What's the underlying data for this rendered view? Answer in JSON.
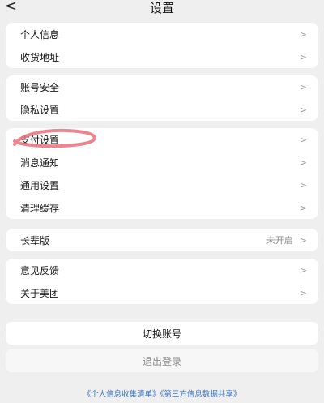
{
  "header": {
    "title": "设置",
    "back_glyph": "<"
  },
  "groups": [
    {
      "items": [
        {
          "label": "个人信息",
          "chevron": ">"
        },
        {
          "label": "收货地址",
          "chevron": ">"
        }
      ]
    },
    {
      "items": [
        {
          "label": "账号安全",
          "chevron": ">"
        },
        {
          "label": "隐私设置",
          "chevron": ">"
        }
      ]
    },
    {
      "items": [
        {
          "label": "支付设置",
          "chevron": ">"
        },
        {
          "label": "消息通知",
          "chevron": ">"
        },
        {
          "label": "通用设置",
          "chevron": ">"
        },
        {
          "label": "清理缓存",
          "chevron": ">"
        }
      ]
    },
    {
      "items": [
        {
          "label": "长辈版",
          "value": "未开启",
          "chevron": ">"
        }
      ]
    },
    {
      "items": [
        {
          "label": "意见反馈",
          "chevron": ">"
        },
        {
          "label": "关于美团",
          "chevron": ">"
        }
      ]
    }
  ],
  "actions": {
    "switch_account": "切换账号",
    "logout": "退出登录"
  },
  "footer": {
    "links": "《个人信息收集清单》《第三方信息数据共享》"
  },
  "colors": {
    "background": "#efefef",
    "card": "#ffffff",
    "link": "#3b76c4",
    "highlight": "#e8707c"
  }
}
